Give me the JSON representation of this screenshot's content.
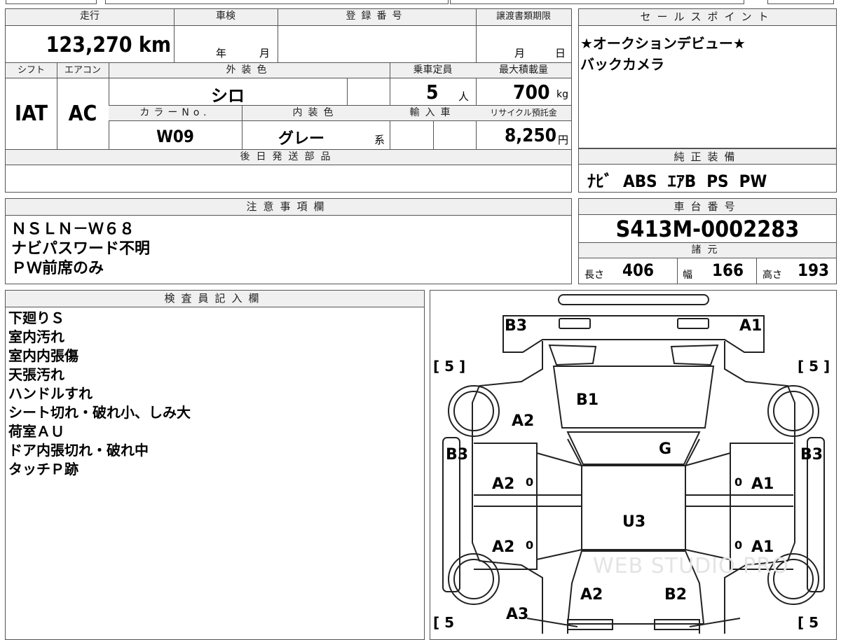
{
  "headers": {
    "mileage": "走行",
    "inspection": "車検",
    "registration": "登録番号",
    "transfer_deadline": "譲渡書類期限",
    "sales_point": "セールスポイント",
    "shift": "シフト",
    "aircon": "エアコン",
    "exterior_color": "外装色",
    "capacity": "乗車定員",
    "max_load": "最大積載量",
    "color_no": "カラーNo.",
    "interior_color": "内装色",
    "import": "輸入車",
    "recycle": "リサイクル預託金",
    "later_parts": "後日発送部品",
    "equipment": "純正装備",
    "notes": "注意事項欄",
    "chassis": "車台番号",
    "specs": "諸元",
    "inspector": "検査員記入欄"
  },
  "values": {
    "mileage": "123,270 km",
    "inspection_year": "年",
    "inspection_month": "月",
    "transfer_month": "月",
    "transfer_day": "日",
    "shift": "IAT",
    "aircon": "AC",
    "exterior_color": "シロ",
    "capacity": "5",
    "capacity_unit": "人",
    "max_load": "700",
    "max_load_unit": "kg",
    "color_no": "W09",
    "interior_color": "グレー",
    "interior_suffix": "系",
    "recycle": "8,250",
    "recycle_unit": "円",
    "chassis": "S413M-0002283",
    "length_label": "長さ",
    "length": "406",
    "width_label": "幅",
    "width": "166",
    "height_label": "高さ",
    "height": "193"
  },
  "sales_points": [
    "★オークションデビュー★",
    "バックカメラ"
  ],
  "equipment": "ﾅﾋﾞ  ABS  ｴｱB  PS  PW",
  "notes": [
    "ＮＳＬＮ－Ｗ６８",
    "ナビパスワード不明",
    "ＰＷ前席のみ"
  ],
  "inspector_notes": [
    "下廻りＳ",
    "室内汚れ",
    "室内内張傷",
    "天張汚れ",
    "ハンドルすれ",
    "シート切れ・破れ小、しみ大",
    "荷室ＡＵ",
    "ドア内張切れ・破れ中",
    "タッチＰ跡"
  ],
  "diagram": {
    "marks": {
      "b3_top": "B3",
      "a1_top": "A1",
      "b1": "B1",
      "a2_front": "A2",
      "g": "G",
      "b3_left": "B3",
      "b3_right": "B3",
      "a2_l1": "A2",
      "a1_r1": "A1",
      "u3": "U3",
      "a2_l2": "A2",
      "a1_r2": "A1",
      "a2_rear": "A2",
      "b2_rear": "B2",
      "a3": "A3"
    },
    "zero": "0",
    "tire_tl": "[ 5 ]",
    "tire_tr": "[ 5 ]",
    "tire_bl": "[ 5",
    "tire_br": "[ 5",
    "watermark": "WEB STUDIO PRO"
  }
}
